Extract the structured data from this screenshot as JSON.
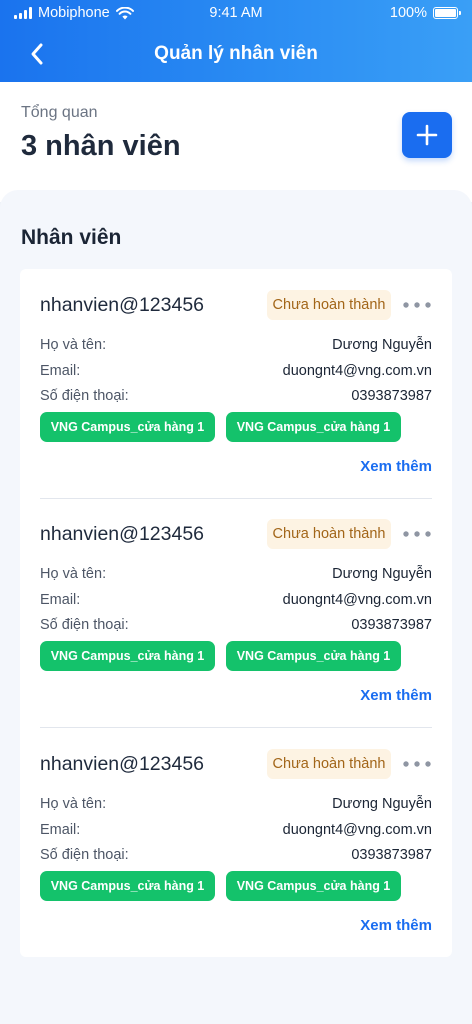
{
  "status_bar": {
    "carrier": "Mobiphone",
    "time": "9:41 AM",
    "battery": "100%",
    "icons": [
      "signal-icon",
      "wifi-icon",
      "battery-icon"
    ]
  },
  "header": {
    "title": "Quản lý nhân viên",
    "back_icon": "chevron-left-icon",
    "colors": {
      "gradient_start": "#1a73ee",
      "gradient_end": "#3a9ff6"
    }
  },
  "summary": {
    "label": "Tổng quan",
    "count_text": "3 nhân viên",
    "add_icon": "plus-icon"
  },
  "section": {
    "title": "Nhân viên"
  },
  "employees": [
    {
      "username": "nhanvien@123456",
      "status": "Chưa hoàn thành",
      "fields": [
        {
          "label": "Họ và tên:",
          "value": "Dương Nguyễn"
        },
        {
          "label": "Email:",
          "value": "duongnt4@vng.com.vn"
        },
        {
          "label": "Số điện thoại:",
          "value": "0393873987"
        }
      ],
      "stores": [
        "VNG Campus_cửa hàng 1",
        "VNG Campus_cửa hàng 1"
      ],
      "see_more": "Xem thêm"
    },
    {
      "username": "nhanvien@123456",
      "status": "Chưa hoàn thành",
      "fields": [
        {
          "label": "Họ và tên:",
          "value": "Dương Nguyễn"
        },
        {
          "label": "Email:",
          "value": "duongnt4@vng.com.vn"
        },
        {
          "label": "Số điện thoại:",
          "value": "0393873987"
        }
      ],
      "stores": [
        "VNG Campus_cửa hàng 1",
        "VNG Campus_cửa hàng 1"
      ],
      "see_more": "Xem thêm"
    },
    {
      "username": "nhanvien@123456",
      "status": "Chưa hoàn thành",
      "fields": [
        {
          "label": "Họ và tên:",
          "value": "Dương Nguyễn"
        },
        {
          "label": "Email:",
          "value": "duongnt4@vng.com.vn"
        },
        {
          "label": "Số điện thoại:",
          "value": "0393873987"
        }
      ],
      "stores": [
        "VNG Campus_cửa hàng 1",
        "VNG Campus_cửa hàng 1"
      ],
      "see_more": "Xem thêm"
    }
  ],
  "colors": {
    "primary": "#1a6df0",
    "tag_green": "#14c26b",
    "badge_bg": "#fdf3e3",
    "badge_text": "#a26518"
  }
}
